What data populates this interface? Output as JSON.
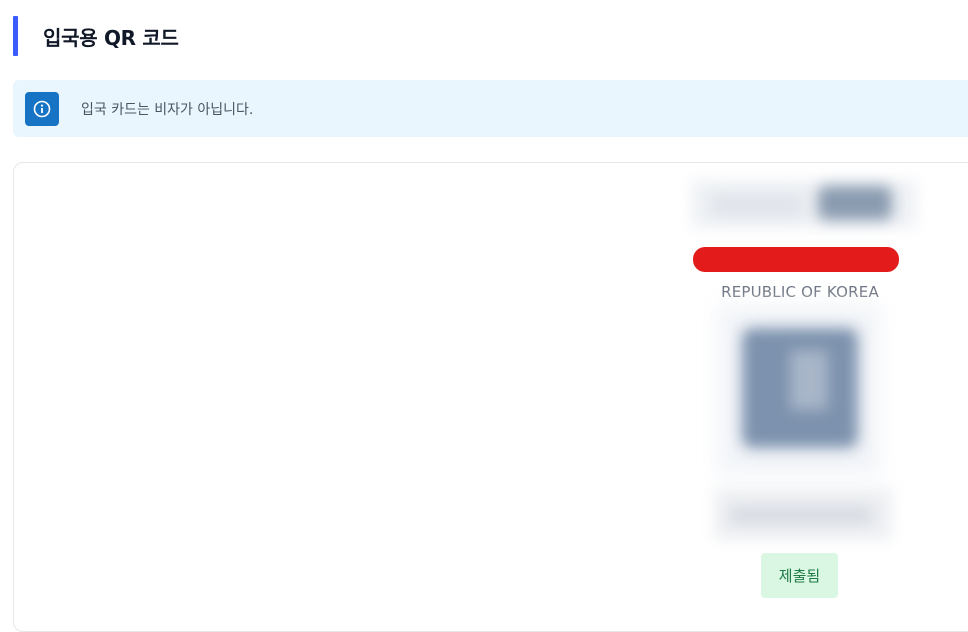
{
  "header": {
    "title": "입국용 QR 코드",
    "accent_color": "#3b5bfd"
  },
  "info_banner": {
    "icon": "info-icon",
    "text": "입국 카드는 비자가 아닙니다."
  },
  "qr_card": {
    "country": "REPUBLIC OF KOREA",
    "status": "제출됨",
    "status_color": "#1f7a43"
  }
}
